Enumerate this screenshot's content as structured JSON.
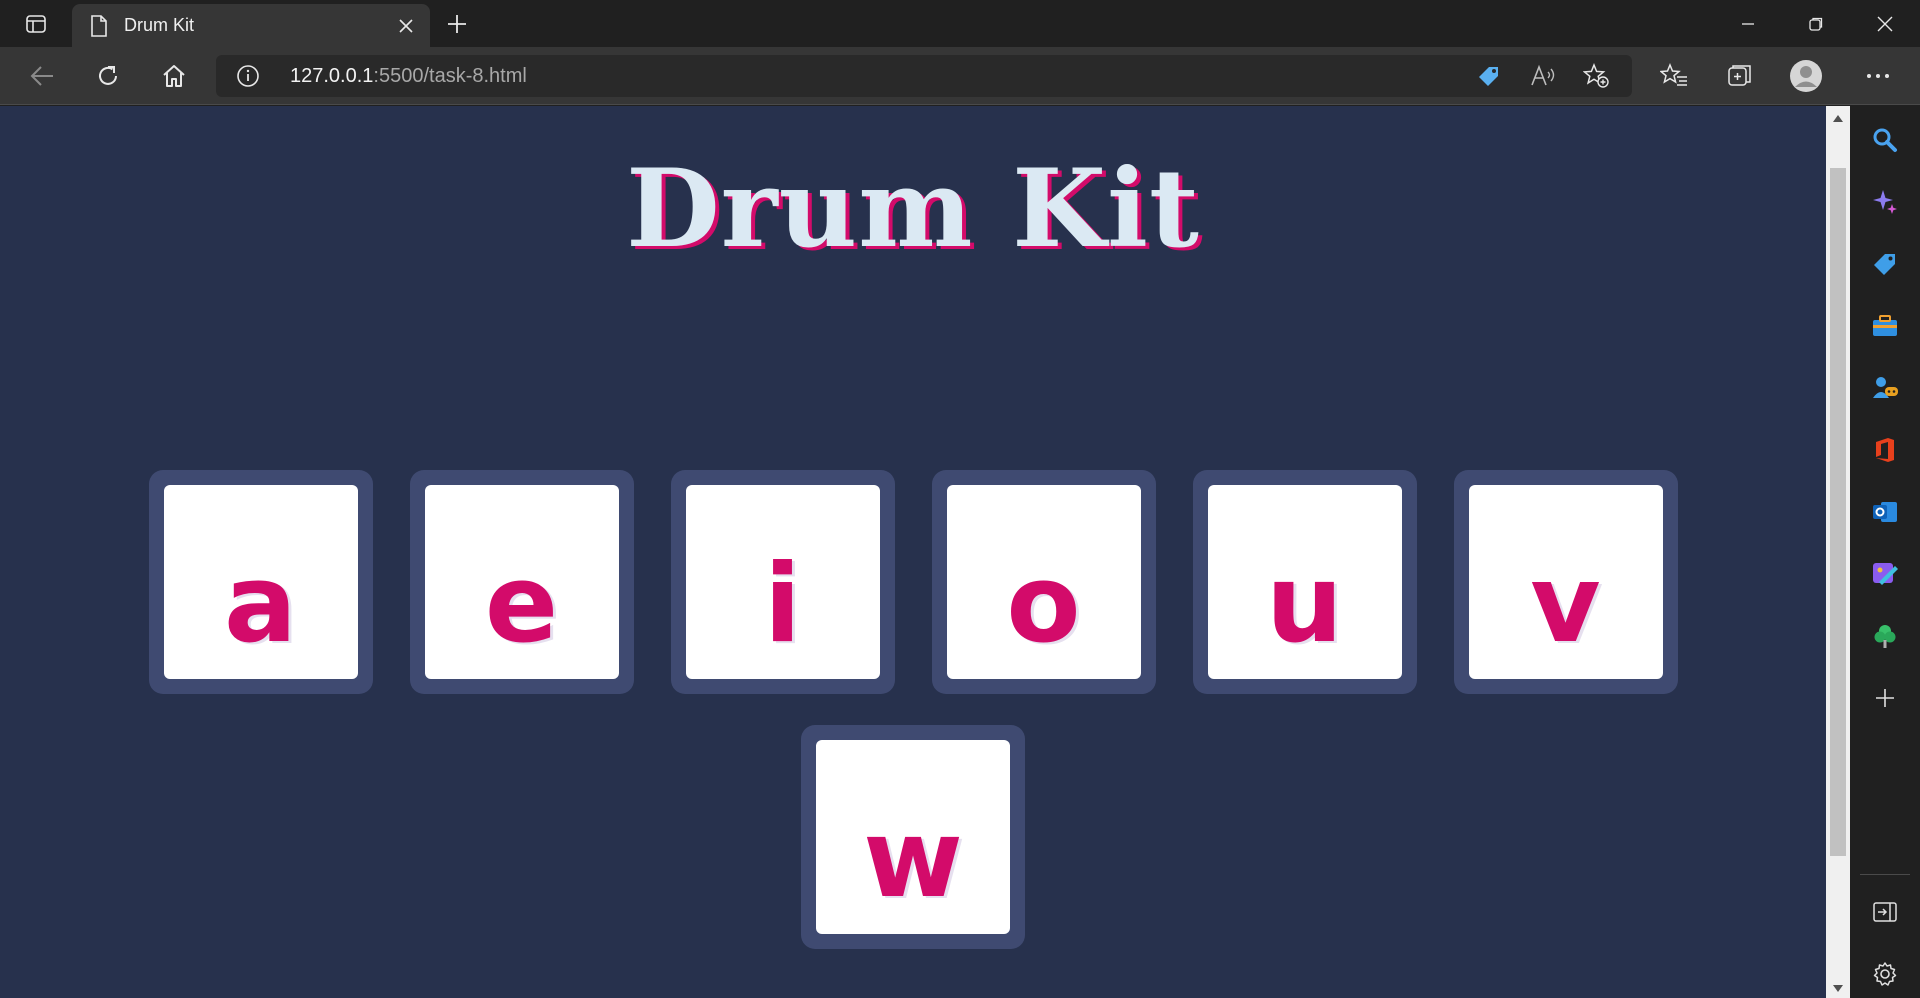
{
  "tab": {
    "title": "Drum Kit",
    "favicon": "document-icon"
  },
  "address": {
    "host": "127.0.0.1",
    "rest": ":5500/task-8.html"
  },
  "page": {
    "title": "Drum Kit",
    "keys_row1": [
      "a",
      "e",
      "i",
      "o",
      "u",
      "v"
    ],
    "keys_row2": [
      "w"
    ]
  },
  "colors": {
    "page_bg": "#27314d",
    "accent_pink": "#d30b6a",
    "title_text": "#dbe9f3",
    "key_frame": "#3f4a71",
    "key_face": "#ffffff"
  },
  "sidebar_icons": [
    "search-icon",
    "copilot-icon",
    "shopping-tag-icon",
    "tools-icon",
    "games-icon",
    "office-icon",
    "outlook-icon",
    "designer-icon",
    "drop-tree-icon",
    "add-icon",
    "hide-sidebar-icon",
    "settings-icon"
  ]
}
